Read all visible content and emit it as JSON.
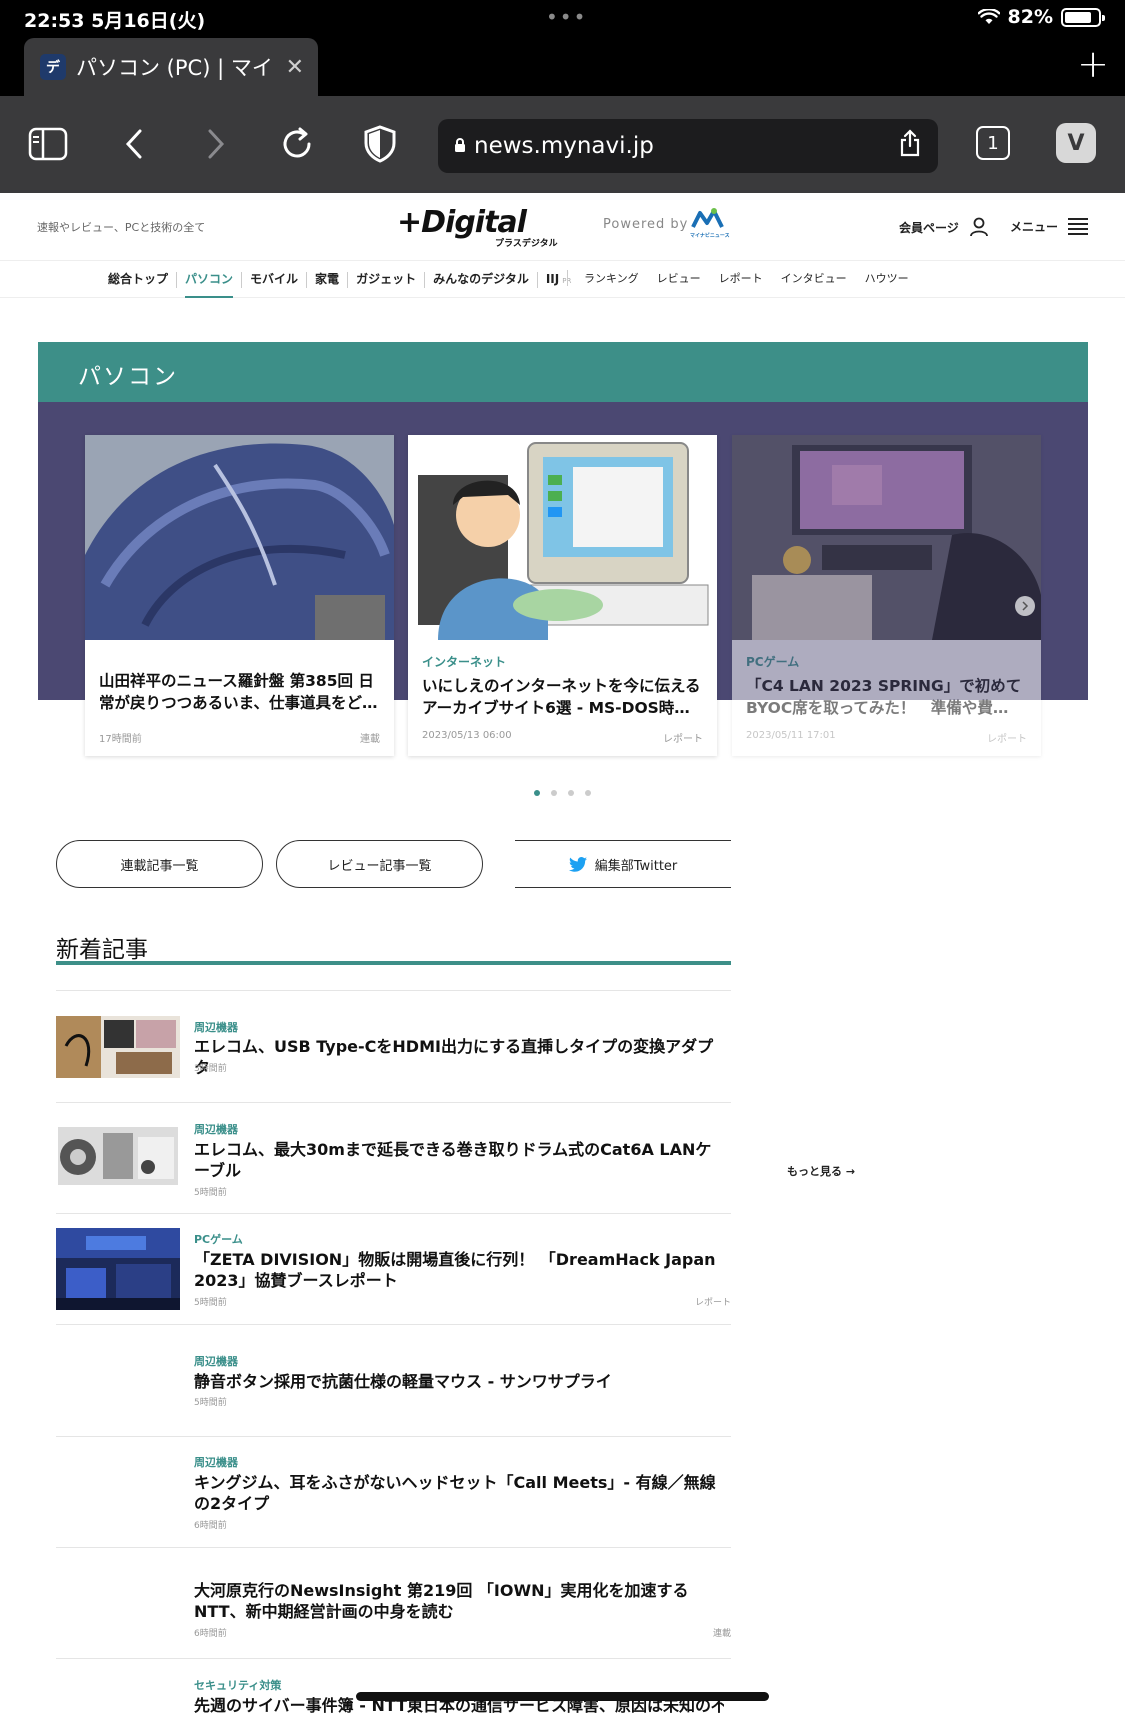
{
  "status": {
    "time": "22:53 5月16日(火)",
    "battery": "82%",
    "battery_level": 0.82
  },
  "tab": {
    "title": "パソコン (PC) | マイ",
    "favicon": "デ"
  },
  "toolbar": {
    "url": "news.mynavi.jp",
    "tab_count": "1"
  },
  "site": {
    "tagline": "速報やレビュー、PCと技術の全て",
    "logo": "+Digital",
    "logo_sub": "プラスデジタル",
    "powered_by": "Powered by",
    "mynavi": "マイナビニュース",
    "member": "会員ページ",
    "menu": "メニュー"
  },
  "nav": {
    "main": [
      "総合トップ",
      "パソコン",
      "モバイル",
      "家電",
      "ガジェット",
      "みんなのデジタル",
      "IIJ"
    ],
    "pr": "PR",
    "sub": [
      "ランキング",
      "レビュー",
      "レポート",
      "インタビュー",
      "ハウツー"
    ]
  },
  "hero": {
    "title": "パソコン",
    "cards": [
      {
        "category": "",
        "title": "山田祥平のニュース羅針盤 第385回 日常が戻りつつあるいま、仕事道具をど…",
        "date": "17時間前",
        "kind": "連載"
      },
      {
        "category": "インターネット",
        "title": "いにしえのインターネットを今に伝えるアーカイブサイト6選 - MS-DOS時…",
        "date": "2023/05/13 06:00",
        "kind": "レポート"
      },
      {
        "category": "PCゲーム",
        "title": "「C4 LAN 2023 SPRING」で初めてBYOC席を取ってみた！　準備や費…",
        "date": "2023/05/11 17:01",
        "kind": "レポート"
      }
    ]
  },
  "buttons": {
    "series": "連載記事一覧",
    "reviews": "レビュー記事一覧",
    "twitter": "編集部Twitter"
  },
  "news": {
    "title": "新着記事",
    "more": "もっと見る →",
    "items": [
      {
        "category": "周辺機器",
        "title": "エレコム、USB Type-CをHDMI出力にする直挿しタイプの変換アダプタ",
        "time": "3時間前",
        "kind": ""
      },
      {
        "category": "周辺機器",
        "title": "エレコム、最大30mまで延長できる巻き取りドラム式のCat6A LANケーブル",
        "time": "5時間前",
        "kind": ""
      },
      {
        "category": "PCゲーム",
        "title": "「ZETA DIVISION」物販は開場直後に行列！ 「DreamHack Japan 2023」協賛ブースレポート",
        "time": "5時間前",
        "kind": "レポート"
      },
      {
        "category": "周辺機器",
        "title": "静音ボタン採用で抗菌仕様の軽量マウス - サンワサプライ",
        "time": "5時間前",
        "kind": ""
      },
      {
        "category": "周辺機器",
        "title": "キングジム、耳をふさがないヘッドセット「Call Meets」- 有線／無線の2タイプ",
        "time": "6時間前",
        "kind": ""
      },
      {
        "category": "",
        "title": "大河原克行のNewsInsight 第219回 「IOWN」実用化を加速するNTT、新中期経営計画の中身を読む",
        "time": "6時間前",
        "kind": "連載"
      },
      {
        "category": "セキュリティ対策",
        "title": "先週のサイバー事件簿 - NTT東日本の通信サービス障害、原因は未知の不具",
        "time": "",
        "kind": ""
      }
    ]
  },
  "colors": {
    "accent": "#3d8f88",
    "hero_bg": "#4b4872"
  }
}
